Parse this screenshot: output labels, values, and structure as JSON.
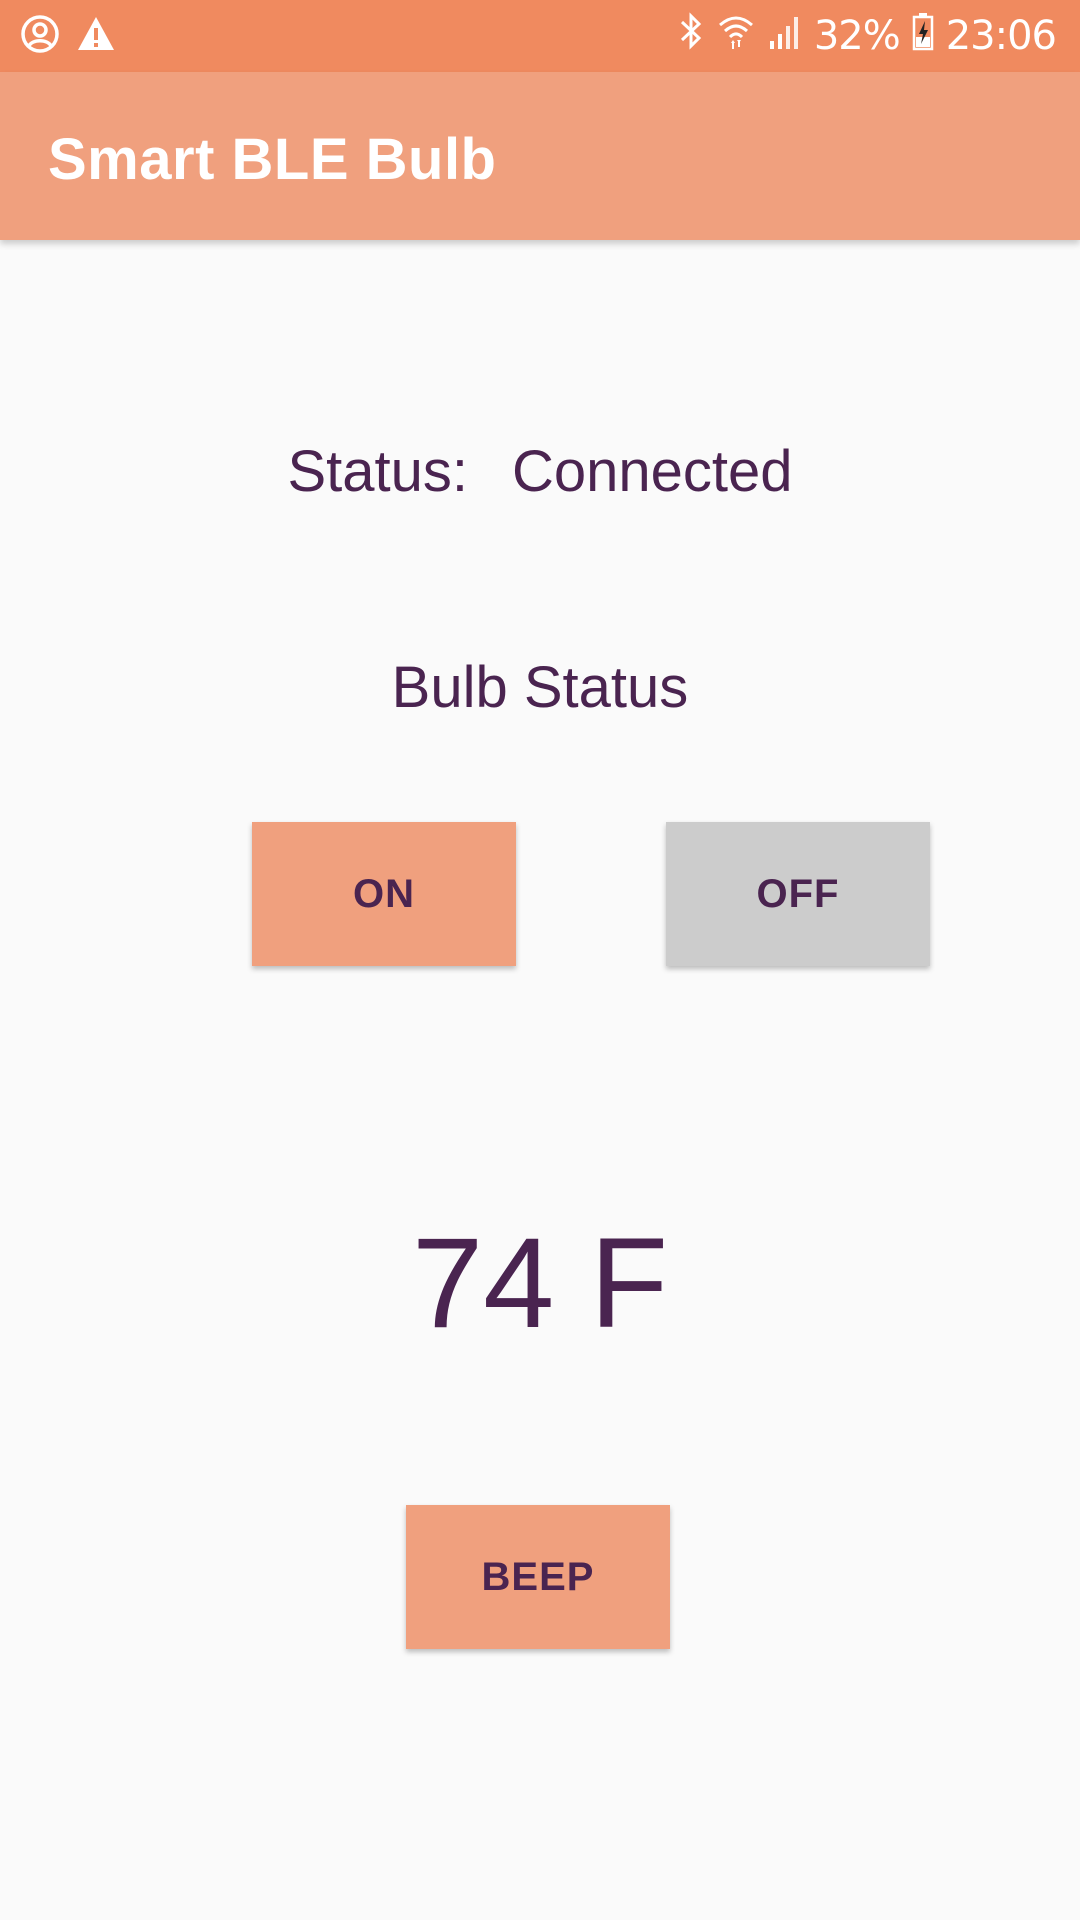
{
  "status_bar": {
    "left_icons": [
      "account-circle-icon",
      "warning-icon"
    ],
    "right_icons": [
      "bluetooth-icon",
      "wifi-icon",
      "signal-icon",
      "battery-charging-icon"
    ],
    "battery_percent": "32%",
    "time": "23:06"
  },
  "app_bar": {
    "title": "Smart BLE Bulb"
  },
  "connection": {
    "label": "Status:",
    "value": "Connected"
  },
  "bulb": {
    "label": "Bulb Status",
    "on_label": "ON",
    "off_label": "OFF"
  },
  "temperature": {
    "value": "74 F"
  },
  "beep": {
    "label": "BEEP"
  },
  "colors": {
    "status_bar": "#F08A5F",
    "app_bar": "#F0A07E",
    "accent_button": "#F0A07E",
    "inactive_button": "#CCCCCC",
    "text": "#4A2450",
    "background": "#FAFAFA"
  }
}
